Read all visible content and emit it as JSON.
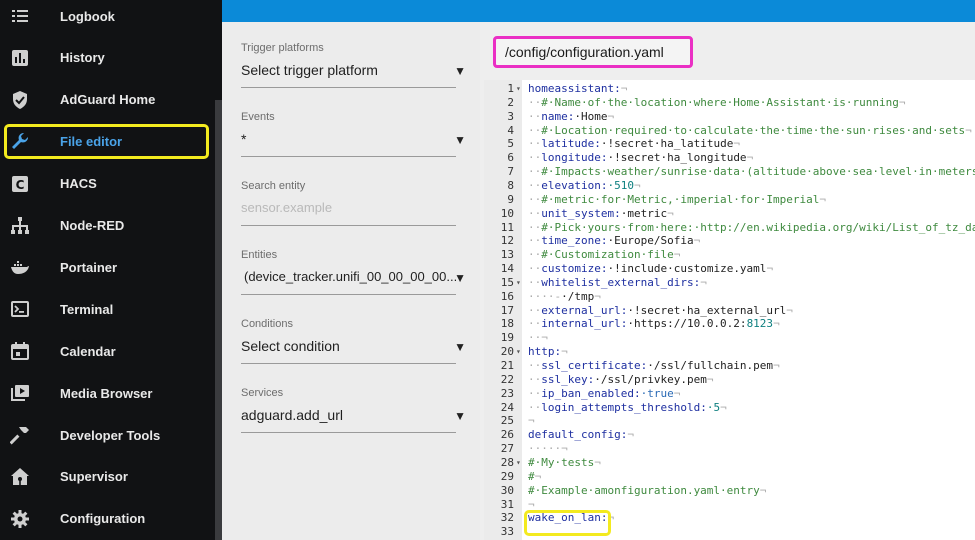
{
  "sidebar": {
    "items": [
      {
        "id": "logbook",
        "label": "Logbook",
        "icon": "list-icon"
      },
      {
        "id": "history",
        "label": "History",
        "icon": "chart-bar-icon"
      },
      {
        "id": "adguard",
        "label": "AdGuard Home",
        "icon": "shield-check-icon"
      },
      {
        "id": "file-editor",
        "label": "File editor",
        "icon": "wrench-icon",
        "active": true
      },
      {
        "id": "hacs",
        "label": "HACS",
        "icon": "hacs-icon"
      },
      {
        "id": "node-red",
        "label": "Node-RED",
        "icon": "sitemap-icon"
      },
      {
        "id": "portainer",
        "label": "Portainer",
        "icon": "docker-icon"
      },
      {
        "id": "terminal",
        "label": "Terminal",
        "icon": "console-icon"
      },
      {
        "id": "calendar",
        "label": "Calendar",
        "icon": "calendar-icon"
      },
      {
        "id": "media-browser",
        "label": "Media Browser",
        "icon": "play-box-icon"
      },
      {
        "id": "developer-tools",
        "label": "Developer Tools",
        "icon": "hammer-icon"
      },
      {
        "id": "supervisor",
        "label": "Supervisor",
        "icon": "home-assistant-icon"
      },
      {
        "id": "configuration",
        "label": "Configuration",
        "icon": "gear-icon"
      }
    ]
  },
  "form": {
    "trigger": {
      "label": "Trigger platforms",
      "value": "Select trigger platform"
    },
    "events": {
      "label": "Events",
      "value": "*"
    },
    "search": {
      "label": "Search entity",
      "placeholder": "sensor.example"
    },
    "entities": {
      "label": "Entities",
      "value": "(device_tracker.unifi_00_00_00_00..."
    },
    "conditions": {
      "label": "Conditions",
      "value": "Select condition"
    },
    "services": {
      "label": "Services",
      "value": "adguard.add_url"
    }
  },
  "editor": {
    "file_path": "/config/configuration.yaml",
    "lines": [
      {
        "n": "1",
        "fold": "▾",
        "html": "<span class='k'>homeassistant:</span><span class='d'>¬</span>"
      },
      {
        "n": "2",
        "html": "<span class='d'>··</span><span class='c'>#·Name·of·the·location·where·Home·Assistant·is·running</span><span class='d'>¬</span>"
      },
      {
        "n": "3",
        "html": "<span class='d'>··</span><span class='k'>name:</span><span class='v'>·Home</span><span class='d'>¬</span>"
      },
      {
        "n": "4",
        "html": "<span class='d'>··</span><span class='c'>#·Location·required·to·calculate·the·time·the·sun·rises·and·sets</span><span class='d'>¬</span>"
      },
      {
        "n": "5",
        "html": "<span class='d'>··</span><span class='k'>latitude:</span><span class='v'>·!secret·ha_latitude</span><span class='d'>¬</span>"
      },
      {
        "n": "6",
        "html": "<span class='d'>··</span><span class='k'>longitude:</span><span class='v'>·!secret·ha_longitude</span><span class='d'>¬</span>"
      },
      {
        "n": "7",
        "html": "<span class='d'>··</span><span class='c'>#·Impacts·weather/sunrise·data·(altitude·above·sea·level·in·meters)</span>"
      },
      {
        "n": "8",
        "html": "<span class='d'>··</span><span class='k'>elevation:</span><span class='n'>·510</span><span class='d'>¬</span>"
      },
      {
        "n": "9",
        "html": "<span class='d'>··</span><span class='c'>#·metric·for·Metric,·imperial·for·Imperial</span><span class='d'>¬</span>"
      },
      {
        "n": "10",
        "html": "<span class='d'>··</span><span class='k'>unit_system:</span><span class='v'>·metric</span><span class='d'>¬</span>"
      },
      {
        "n": "11",
        "html": "<span class='d'>··</span><span class='c'>#·Pick·yours·from·here:·http://en.wikipedia.org/wiki/List_of_tz_dat</span>"
      },
      {
        "n": "12",
        "html": "<span class='d'>··</span><span class='k'>time_zone:</span><span class='v'>·Europe/Sofia</span><span class='d'>¬</span>"
      },
      {
        "n": "13",
        "html": "<span class='d'>··</span><span class='c'>#·Customization·file</span><span class='d'>¬</span>"
      },
      {
        "n": "14",
        "html": "<span class='d'>··</span><span class='k'>customize:</span><span class='v'>·!include·customize.yaml</span><span class='d'>¬</span>"
      },
      {
        "n": "15",
        "fold": "▾",
        "html": "<span class='d'>··</span><span class='k'>whitelist_external_dirs:</span><span class='d'>¬</span>"
      },
      {
        "n": "16",
        "html": "<span class='d'>····-</span><span class='v'>·/tmp</span><span class='d'>¬</span>"
      },
      {
        "n": "17",
        "html": "<span class='d'>··</span><span class='k'>external_url:</span><span class='v'>·!secret·ha_external_url</span><span class='d'>¬</span>"
      },
      {
        "n": "18",
        "html": "<span class='d'>··</span><span class='k'>internal_url:</span><span class='v'>·https://10.0.0.2:</span><span class='n'>8123</span><span class='d'>¬</span>"
      },
      {
        "n": "19",
        "html": "<span class='d'>··¬</span>"
      },
      {
        "n": "20",
        "fold": "▾",
        "html": "<span class='k'>http:</span><span class='d'>¬</span>"
      },
      {
        "n": "21",
        "html": "<span class='d'>··</span><span class='k'>ssl_certificate:</span><span class='v'>·/ssl/fullchain.pem</span><span class='d'>¬</span>"
      },
      {
        "n": "22",
        "html": "<span class='d'>··</span><span class='k'>ssl_key:</span><span class='v'>·/ssl/privkey.pem</span><span class='d'>¬</span>"
      },
      {
        "n": "23",
        "html": "<span class='d'>··</span><span class='k'>ip_ban_enabled:</span><span class='b'>·true</span><span class='d'>¬</span>"
      },
      {
        "n": "24",
        "html": "<span class='d'>··</span><span class='k'>login_attempts_threshold:</span><span class='n'>·5</span><span class='d'>¬</span>"
      },
      {
        "n": "25",
        "html": "<span class='d'>¬</span>"
      },
      {
        "n": "26",
        "html": "<span class='k'>default_config:</span><span class='d'>¬</span>"
      },
      {
        "n": "27",
        "html": "<span class='d'>·····¬</span>"
      },
      {
        "n": "28",
        "fold": "▾",
        "html": "<span class='c'>#·My·tests</span><span class='d'>¬</span>"
      },
      {
        "n": "29",
        "html": "<span class='c'>#</span><span class='d'>¬</span>"
      },
      {
        "n": "30",
        "html": "<span class='c'>#·Example·amonfiguration.yaml·entry</span><span class='d'>¬</span>"
      },
      {
        "n": "31",
        "html": "<span class='d'>¬</span>"
      },
      {
        "n": "32",
        "html": "<span class='k'>wake_on_lan:</span><span class='d'>¬</span>"
      },
      {
        "n": "33",
        "html": ""
      }
    ]
  },
  "colors": {
    "accent": "#0b8ad8",
    "active": "#4aa3e8",
    "highlight_yellow": "#f3ea1f",
    "highlight_pink": "#ea2fc4"
  }
}
